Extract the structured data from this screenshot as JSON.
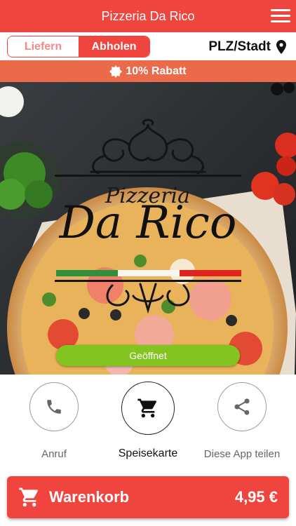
{
  "header": {
    "title": "Pizzeria Da Rico",
    "menu_icon": "hamburger-menu-icon"
  },
  "order_mode": {
    "options": [
      "Liefern",
      "Abholen"
    ],
    "selected": "Abholen"
  },
  "location": {
    "label": "PLZ/Stadt",
    "icon": "location-pin-icon"
  },
  "discount": {
    "text": "10% Rabatt",
    "icon": "badge-icon"
  },
  "hero": {
    "logo_script": "Pizzeria",
    "logo_name": "Da Rico",
    "status_button": "Geöffnet"
  },
  "actions": [
    {
      "label": "Anruf",
      "icon": "phone-icon"
    },
    {
      "label": "Speisekarte",
      "icon": "shopping-cart-icon"
    },
    {
      "label": "Diese App teilen",
      "icon": "share-icon"
    }
  ],
  "cart": {
    "label": "Warenkorb",
    "total": "4,95 €",
    "icon": "shopping-cart-icon"
  },
  "colors": {
    "brand": "#f0453f",
    "discount_bar": "#ea6a4a",
    "open_green": "#84c421"
  }
}
